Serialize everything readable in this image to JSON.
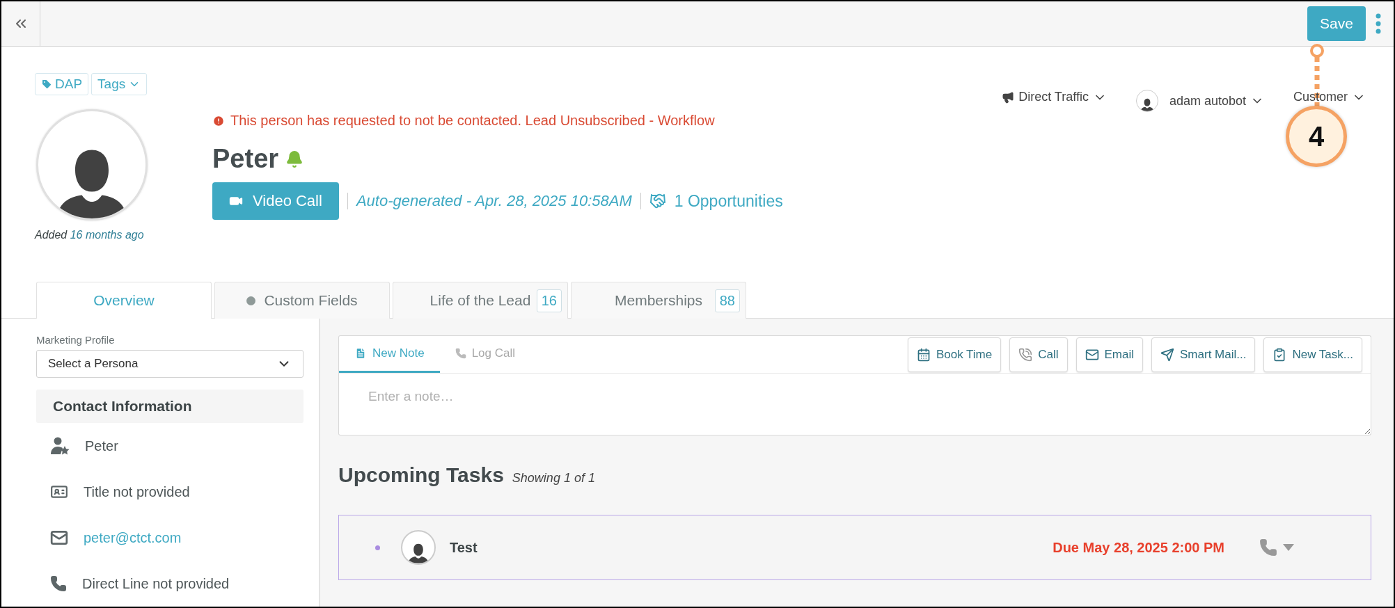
{
  "topbar": {
    "save": "Save"
  },
  "header": {
    "tags": [
      {
        "kind": "tag",
        "label": "DAP"
      },
      {
        "kind": "dropdown",
        "label": "Tags"
      }
    ],
    "alert": "This person has requested to not be contacted. Lead Unsubscribed - Workflow",
    "name": "Peter",
    "video_call": "Video Call",
    "auto_generated": "Auto-generated - Apr. 28, 2025 10:58AM",
    "opportunities": "1 Opportunities",
    "added_prefix": "Added",
    "added_time": "16 months ago",
    "selectors": [
      {
        "kind": "source",
        "label": "Direct Traffic"
      },
      {
        "kind": "owner",
        "label": "adam autobot"
      },
      {
        "kind": "stage",
        "label": "Customer"
      }
    ]
  },
  "callout": {
    "label": "4"
  },
  "tabs": [
    {
      "label": "Overview",
      "selected": true
    },
    {
      "label": "Custom Fields",
      "selected": false,
      "dot": true
    },
    {
      "label": "Life of the Lead",
      "selected": false,
      "count": "16"
    },
    {
      "label": "Memberships",
      "selected": false,
      "count": "88"
    }
  ],
  "sidebar": {
    "profile_label": "Marketing Profile",
    "persona": "Select a Persona",
    "section": "Contact Information",
    "rows": [
      {
        "kind": "person",
        "text": "Peter"
      },
      {
        "kind": "title",
        "text": "Title not provided"
      },
      {
        "kind": "email",
        "text": "peter@ctct.com"
      },
      {
        "kind": "phone",
        "text": "Direct Line not provided"
      }
    ]
  },
  "composer": {
    "tabs": [
      {
        "kind": "note",
        "label": "New Note",
        "selected": true
      },
      {
        "kind": "call",
        "label": "Log Call",
        "selected": false
      }
    ],
    "actions": [
      {
        "kind": "calendar",
        "label": "Book Time"
      },
      {
        "kind": "call",
        "label": "Call"
      },
      {
        "kind": "email",
        "label": "Email"
      },
      {
        "kind": "send",
        "label": "Smart Mail..."
      },
      {
        "kind": "task",
        "label": "New Task..."
      }
    ],
    "placeholder": "Enter a note…"
  },
  "tasks": {
    "title": "Upcoming Tasks",
    "showing": "Showing 1 of 1",
    "items": [
      {
        "name": "Test",
        "due": "Due May 28, 2025 2:00 PM",
        "color": "#a98ce0"
      }
    ]
  }
}
